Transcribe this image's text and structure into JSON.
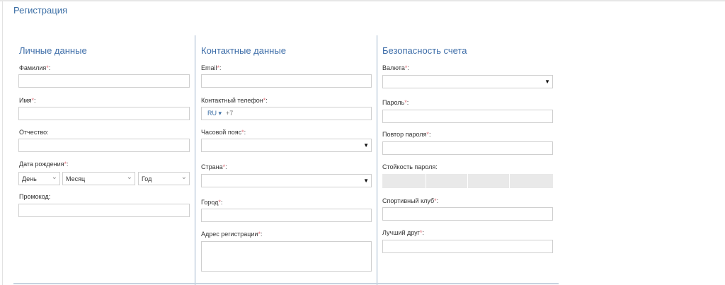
{
  "page_title": "Регистрация",
  "personal": {
    "title": "Личные данные",
    "last_name_label": "Фамилия",
    "first_name_label": "Имя",
    "patronymic_label": "Отчество",
    "birth_date_label": "Дата рождения",
    "day_value": "День",
    "month_value": "Месяц",
    "year_value": "Год",
    "promo_label": "Промокод:"
  },
  "contact": {
    "title": "Контактные данные",
    "email_label": "Email",
    "phone_label": "Контактный телефон",
    "phone_country": "RU ▾",
    "phone_code": "+7",
    "timezone_label": "Часовой пояс",
    "country_label": "Страна",
    "city_label": "Город",
    "address_label": "Адрес регистрации"
  },
  "security": {
    "title": "Безопасность счета",
    "currency_label": "Валюта",
    "password_label": "Пароль",
    "password_repeat_label": "Повтор пароля",
    "strength_label": "Стойкость пароля:",
    "strength_level": 0,
    "sport_club_label": "Спортивный клуб",
    "best_friend_label": "Лучший друг"
  },
  "required_mark": "*",
  "colon": ":",
  "colors": {
    "accent": "#3b6ea5",
    "required": "#e0707a",
    "border": "#cfcfcf",
    "divider": "#9fb4cc"
  }
}
